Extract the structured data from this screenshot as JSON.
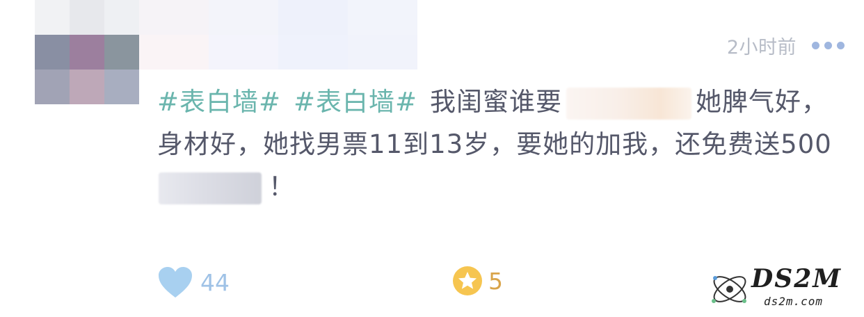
{
  "header": {
    "timestamp": "2小时前",
    "more_icon": "more-dots-icon"
  },
  "post": {
    "hashtags": [
      "#表白墙#",
      "#表白墙#"
    ],
    "segment1": "我闺蜜谁要",
    "segment2": "她脾气好，身材好，她找男票11到13岁，要她的加我，还免费送500",
    "segment3": "！"
  },
  "actions": {
    "like": {
      "icon": "heart-icon",
      "count": "44",
      "color": "#a8d0f0"
    },
    "favorite": {
      "icon": "star-icon",
      "count": "5",
      "color": "#f6c550"
    }
  },
  "watermark": {
    "brand": "DS2M",
    "url": "ds2m.com"
  }
}
